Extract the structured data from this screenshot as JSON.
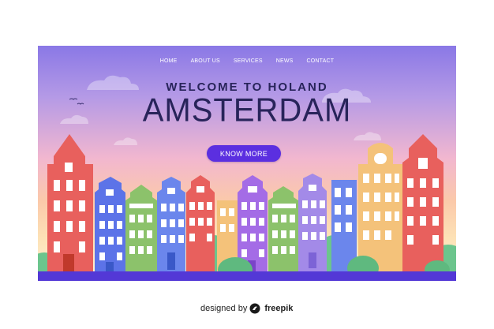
{
  "nav": {
    "items": [
      "HOME",
      "ABOUT US",
      "SERVICES",
      "NEWS",
      "CONTACT"
    ]
  },
  "hero": {
    "headline": "WELCOME TO HOLAND",
    "title": "AMSTERDAM",
    "button_label": "KNOW MORE"
  },
  "footer": {
    "prefix": "designed by",
    "brand": "freepik",
    "logo_icon": "freepik-logo-icon"
  },
  "colors": {
    "accent": "#5b2fe0",
    "heading": "#28245a",
    "water": "#5338d6",
    "houses": [
      "#e8605d",
      "#5c73e8",
      "#8cc26b",
      "#6b86ec",
      "#e8605d",
      "#f4c27a",
      "#a46ce6",
      "#8cc26b",
      "#a38ae8",
      "#6b86ec",
      "#f4c27a",
      "#e8605d"
    ]
  }
}
